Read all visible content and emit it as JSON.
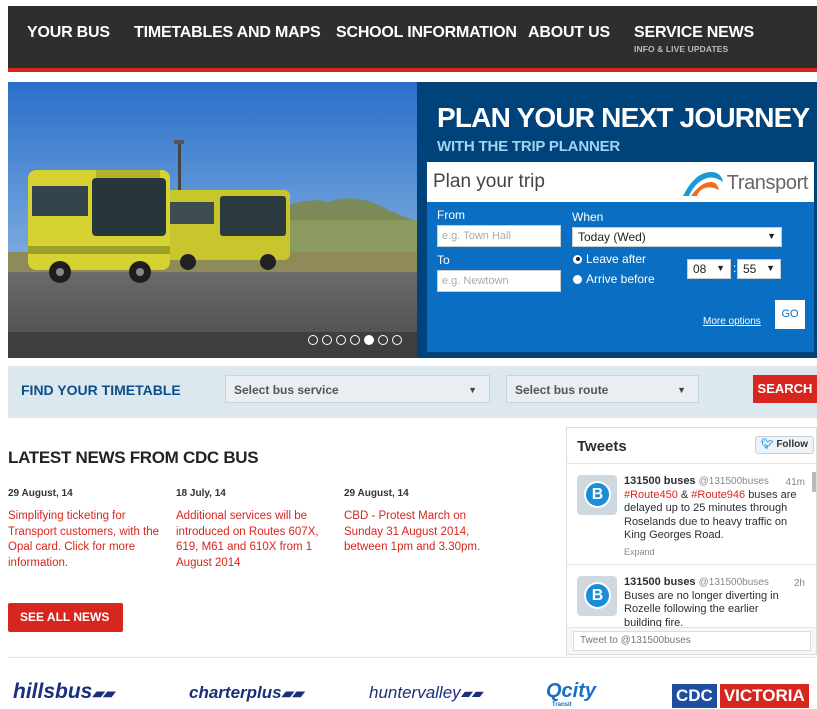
{
  "nav": {
    "items": [
      {
        "label": "YOUR BUS"
      },
      {
        "label": "TIMETABLES AND MAPS"
      },
      {
        "label": "SCHOOL INFORMATION"
      },
      {
        "label": "ABOUT US"
      },
      {
        "label": "SERVICE NEWS",
        "sub": "INFO & LIVE UPDATES"
      }
    ]
  },
  "hero": {
    "slide_count": 7,
    "active_slide": 5
  },
  "planner": {
    "title": "PLAN YOUR NEXT JOURNEY",
    "subtitle": "WITH THE TRIP PLANNER",
    "plan_trip": "Plan your trip",
    "logo_text": "Transport",
    "from_label": "From",
    "from_placeholder": "e.g. Town Hall",
    "to_label": "To",
    "to_placeholder": "e.g. Newtown",
    "when_label": "When",
    "when_value": "Today (Wed)",
    "leave_after": "Leave after",
    "arrive_before": "Arrive before",
    "hour": "08",
    "minute": "55",
    "colon": ":",
    "more_options": "More options",
    "go": "GO"
  },
  "timetable": {
    "label": "FIND YOUR TIMETABLE",
    "service_select": "Select bus service",
    "route_select": "Select bus route",
    "search": "SEARCH"
  },
  "news": {
    "title": "LATEST NEWS FROM CDC BUS",
    "items": [
      {
        "date": "29 August, 14",
        "text": "Simplifying ticketing for Transport customers, with the Opal card. Click for more information."
      },
      {
        "date": "18 July, 14",
        "text": "Additional services will be introduced on Routes 607X, 619, M61 and 610X from 1 August 2014"
      },
      {
        "date": "29 August, 14",
        "text": "CBD - Protest March on Sunday 31 August 2014, between 1pm and 3.30pm."
      }
    ],
    "see_all": "SEE ALL NEWS"
  },
  "tweets": {
    "title": "Tweets",
    "follow": "Follow",
    "items": [
      {
        "name": "131500 buses",
        "handle": "@131500buses",
        "time": "41m",
        "tag1": "#Route450",
        "amp": "&",
        "tag2": "#Route946",
        "text": "buses are delayed up to 25 minutes through Roselands due to heavy traffic on King Georges Road.",
        "expand": "Expand",
        "avatar_letter": "B"
      },
      {
        "name": "131500 buses",
        "handle": "@131500buses",
        "time": "2h",
        "text": "Buses are no longer diverting in Rozelle following the earlier building fire.",
        "avatar_letter": "B"
      }
    ],
    "compose_placeholder": "Tweet to @131500buses"
  },
  "partners": [
    {
      "name": "hillsbus"
    },
    {
      "name": "charterplus"
    },
    {
      "name": "huntervalley"
    },
    {
      "name": "Qcity",
      "sub": "Transit"
    },
    {
      "name_a": "CDC",
      "name_b": "VICTORIA"
    }
  ],
  "colors": {
    "nav_bg": "#2e2e2e",
    "accent_red": "#d7261e",
    "planner_dark": "#00437a",
    "planner_blue": "#0a6fc2",
    "timetable_bar": "#dde8ee"
  }
}
